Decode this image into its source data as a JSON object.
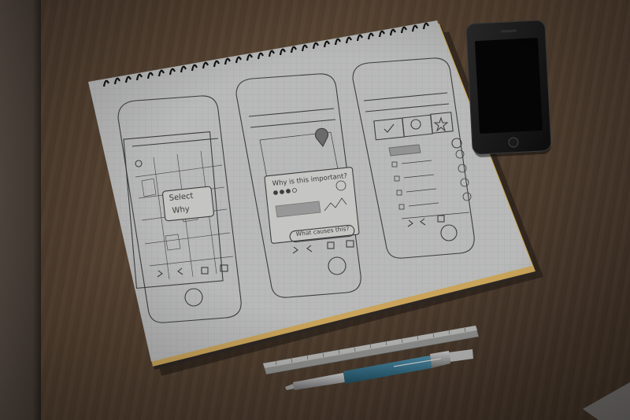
{
  "scene": {
    "description_labels": {
      "sketch_1": {
        "select_label": "Select",
        "why_label": "Why"
      },
      "sketch_2": {
        "question": "Why is this important?",
        "button": "What causes this?"
      },
      "sketch_3": {}
    }
  },
  "colors": {
    "desk": "#56432f",
    "paper": "#b9b9b7",
    "phone": "#161616",
    "pen_barrel": "#2f6a82",
    "ruler": "#9a9a96"
  },
  "icons": [
    "notebook-spiral-icon",
    "smartphone-icon",
    "pen-icon",
    "ruler-icon",
    "map-pin-icon",
    "checkbox-icon",
    "star-icon",
    "chat-bubble-icon"
  ]
}
